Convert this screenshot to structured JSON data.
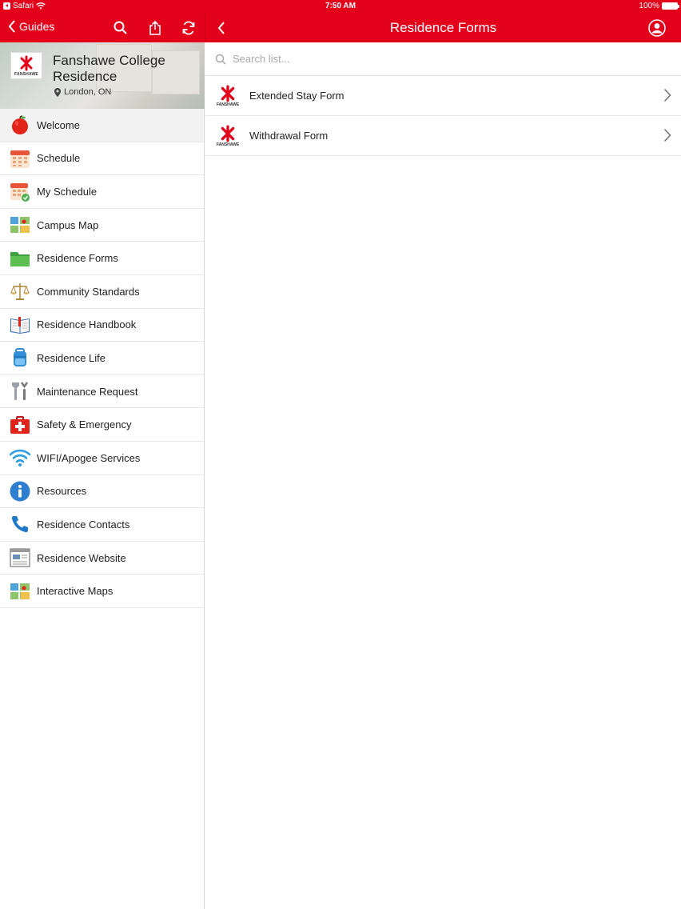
{
  "status_bar": {
    "app": "Safari",
    "time": "7:50 AM",
    "battery": "100%"
  },
  "nav": {
    "back_label": "Guides",
    "title": "Residence Forms"
  },
  "sidebar": {
    "guide_title": "Fanshawe College Residence",
    "location": "London, ON",
    "logo_text": "FANSHAWE",
    "items": [
      {
        "label": "Welcome",
        "icon": "apple-icon"
      },
      {
        "label": "Schedule",
        "icon": "calendar-icon"
      },
      {
        "label": "My Schedule",
        "icon": "calendar-check-icon"
      },
      {
        "label": "Campus Map",
        "icon": "map-icon"
      },
      {
        "label": "Residence Forms",
        "icon": "folder-icon"
      },
      {
        "label": "Community Standards",
        "icon": "scales-icon"
      },
      {
        "label": "Residence Handbook",
        "icon": "book-icon"
      },
      {
        "label": "Residence Life",
        "icon": "backpack-icon"
      },
      {
        "label": "Maintenance Request",
        "icon": "tools-icon"
      },
      {
        "label": "Safety & Emergency",
        "icon": "first-aid-icon"
      },
      {
        "label": "WIFI/Apogee Services",
        "icon": "wifi-icon"
      },
      {
        "label": "Resources",
        "icon": "info-icon"
      },
      {
        "label": "Residence Contacts",
        "icon": "phone-icon"
      },
      {
        "label": "Residence Website",
        "icon": "browser-icon"
      },
      {
        "label": "Interactive Maps",
        "icon": "map-icon"
      }
    ]
  },
  "main": {
    "search_placeholder": "Search list...",
    "forms": [
      {
        "label": "Extended Stay Form"
      },
      {
        "label": "Withdrawal Form"
      }
    ]
  },
  "colors": {
    "brand_red": "#e2001a"
  }
}
